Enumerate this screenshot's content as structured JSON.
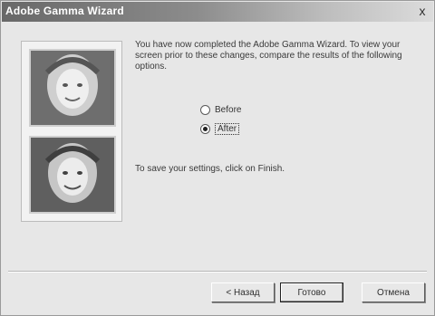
{
  "window": {
    "title": "Adobe Gamma Wizard",
    "close_glyph": "x"
  },
  "content": {
    "message": "You have now completed the Adobe Gamma Wizard. To view your screen prior to these changes, compare the results of the following options.",
    "options": [
      {
        "label": "Before",
        "selected": false
      },
      {
        "label": "After",
        "selected": true
      }
    ],
    "save_text": "To save your settings, click on Finish."
  },
  "buttons": {
    "back_label": "< Назад",
    "finish_label": "Готово",
    "cancel_label": "Отмена"
  },
  "icons": {
    "close": "close-icon",
    "radio": "radio-icon"
  }
}
